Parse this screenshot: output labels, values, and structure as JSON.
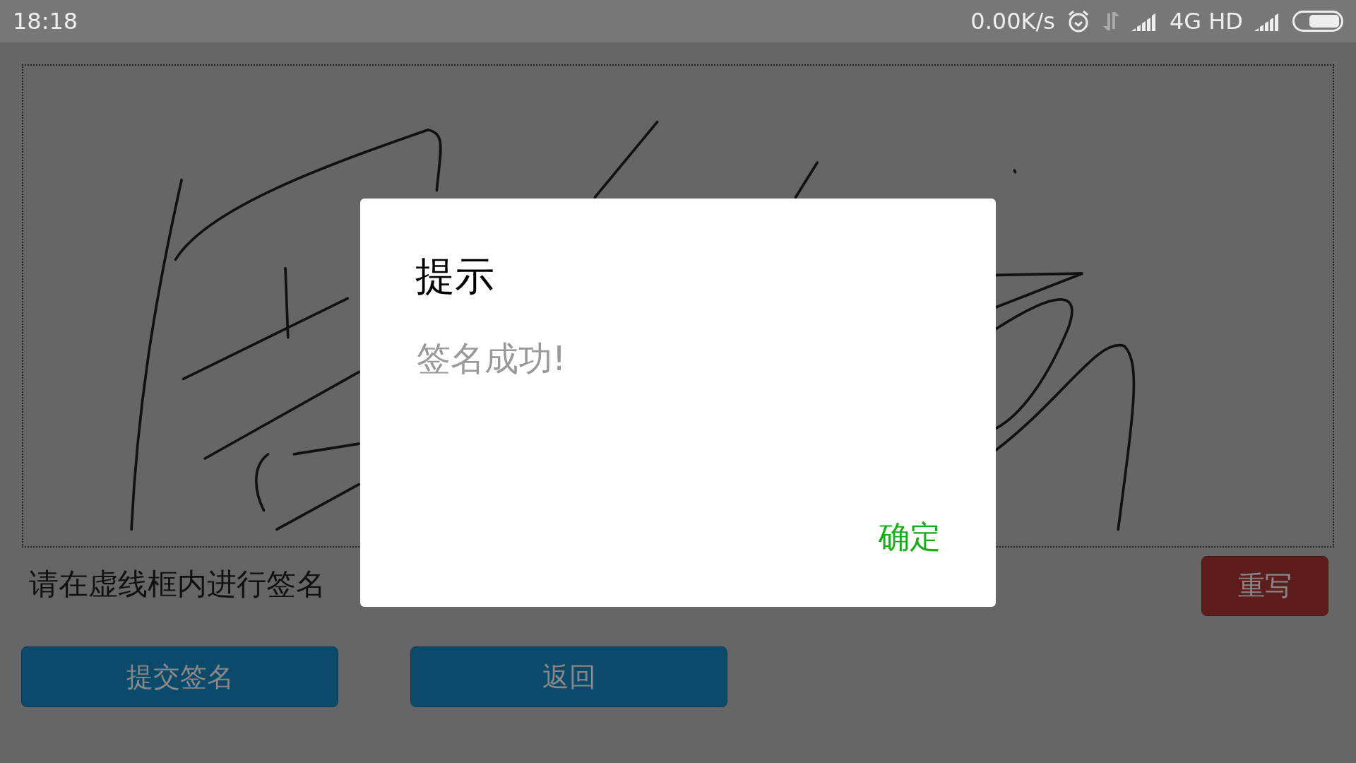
{
  "status_bar": {
    "time": "18:18",
    "network_speed": "0.00K/s",
    "network_type": "4G HD"
  },
  "hint": "请在虚线框内进行签名",
  "reset_button": "重写",
  "buttons": [
    {
      "label": "提交签名"
    },
    {
      "label": "返回"
    }
  ],
  "dialog": {
    "title": "提示",
    "message": "签名成功!",
    "confirm": "确定"
  }
}
